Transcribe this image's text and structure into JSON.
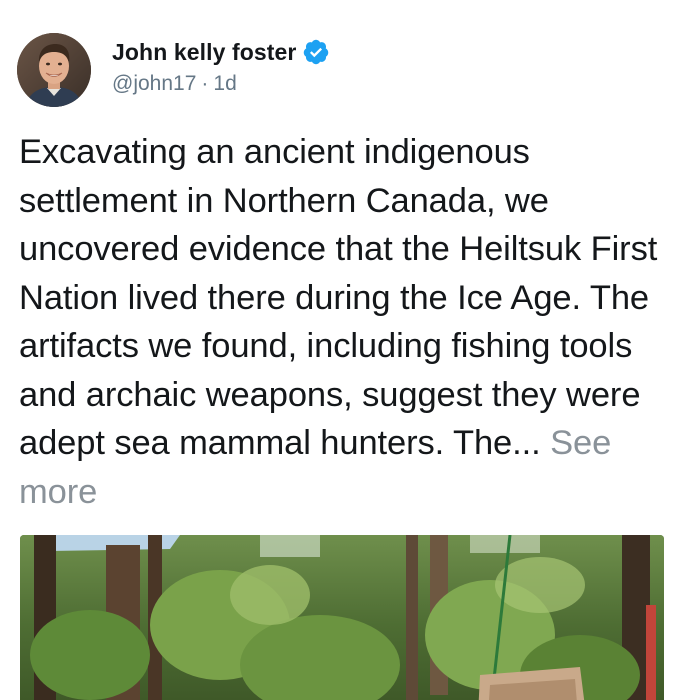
{
  "tweet": {
    "author": {
      "display_name": "John kelly foster",
      "handle": "@john17",
      "separator": "·",
      "time": "1d",
      "verified": true,
      "avatar_icon": "avatar-photo"
    },
    "text": "Excavating an ancient indigenous settlement in Northern Canada, we uncovered evidence that the Heiltsuk First Nation lived there during the Ice Age. The artifacts we found, including fishing tools and archaic weapons, suggest they were adept sea mammal hunters. The... ",
    "see_more_label": "See more",
    "media": {
      "kind": "photo",
      "subject_icon": "forest-excavation-photo"
    }
  },
  "colors": {
    "text": "#14171a",
    "secondary": "#657786",
    "see_more": "#8a9299",
    "verified": "#1da1f2"
  }
}
